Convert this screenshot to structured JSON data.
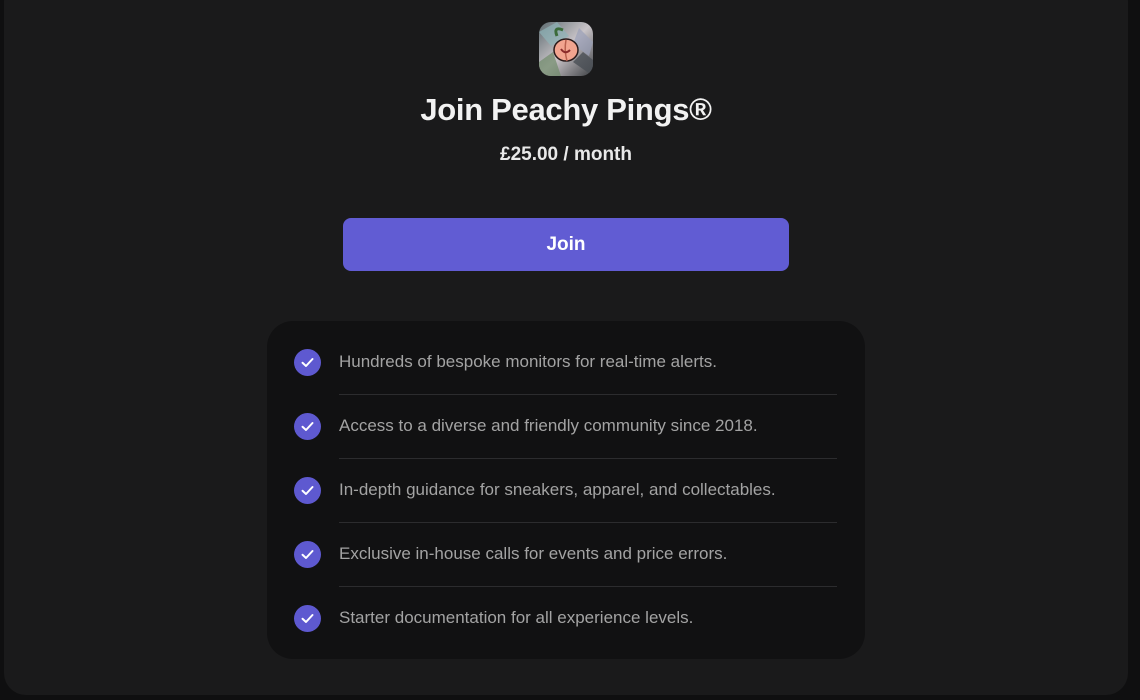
{
  "brand": {
    "logo_icon": "peach-logo-icon"
  },
  "header": {
    "title": "Join Peachy Pings®",
    "price": "£25.00 / month"
  },
  "cta": {
    "join_label": "Join"
  },
  "features": {
    "items": [
      {
        "text": "Hundreds of bespoke monitors for real-time alerts.",
        "icon": "check-icon"
      },
      {
        "text": "Access to a diverse and friendly community since 2018.",
        "icon": "check-icon"
      },
      {
        "text": "In-depth guidance for sneakers, apparel, and collectables.",
        "icon": "check-icon"
      },
      {
        "text": "Exclusive in-house calls for events and price errors.",
        "icon": "check-icon"
      },
      {
        "text": "Starter documentation for all experience levels.",
        "icon": "check-icon"
      }
    ]
  },
  "colors": {
    "accent": "#615cd3",
    "background": "#1a1a1b",
    "card": "#111112",
    "text_primary": "#f2f2f2",
    "text_secondary": "#a3a3a3"
  }
}
